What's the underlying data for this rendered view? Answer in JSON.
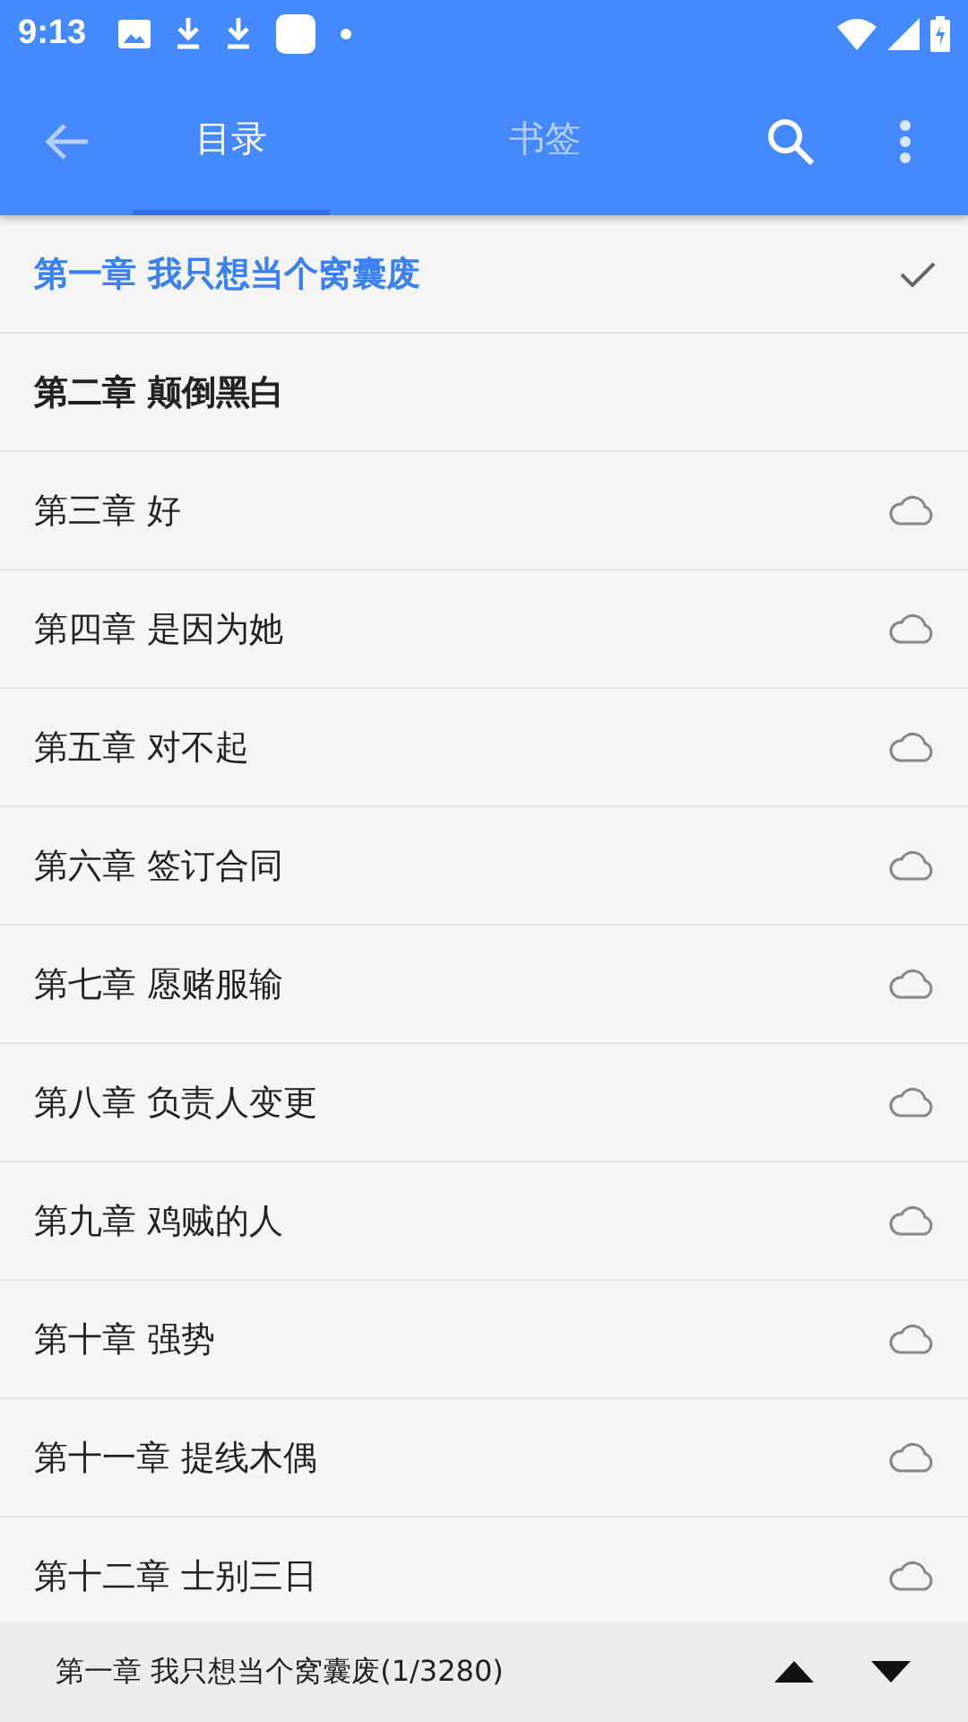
{
  "status_bar": {
    "time": "9:13"
  },
  "toolbar": {
    "tabs": [
      {
        "label": "目录",
        "selected": true
      },
      {
        "label": "书签",
        "selected": false
      }
    ]
  },
  "chapters": [
    {
      "title": "第一章 我只想当个窝囊废",
      "selected": true,
      "cached": true
    },
    {
      "title": "第二章 颠倒黑白",
      "selected": false,
      "cached": true
    },
    {
      "title": "第三章 好",
      "selected": false,
      "cached": false
    },
    {
      "title": "第四章 是因为她",
      "selected": false,
      "cached": false
    },
    {
      "title": "第五章 对不起",
      "selected": false,
      "cached": false
    },
    {
      "title": "第六章 签订合同",
      "selected": false,
      "cached": false
    },
    {
      "title": "第七章 愿赌服输",
      "selected": false,
      "cached": false
    },
    {
      "title": "第八章 负责人变更",
      "selected": false,
      "cached": false
    },
    {
      "title": "第九章 鸡贼的人",
      "selected": false,
      "cached": false
    },
    {
      "title": "第十章 强势",
      "selected": false,
      "cached": false
    },
    {
      "title": "第十一章 提线木偶",
      "selected": false,
      "cached": false
    },
    {
      "title": "第十二章 士别三日",
      "selected": false,
      "cached": false
    }
  ],
  "footer": {
    "current": "第一章 我只想当个窝囊废(1/3280)"
  }
}
